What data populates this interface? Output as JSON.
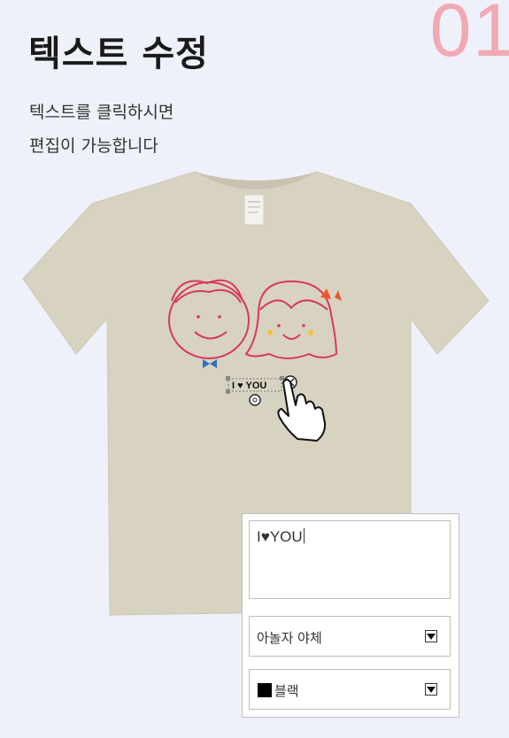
{
  "step_number": "01",
  "title": "텍스트 수정",
  "description": [
    "텍스트를 클릭하시면",
    "편집이 가능합니다"
  ],
  "design": {
    "text": "I ♥ YOU"
  },
  "editor": {
    "text_value": "I♥YOU",
    "font_select": "아놀자 야체",
    "color_select": "블랙"
  },
  "colors": {
    "shirt": "#d8d2c1",
    "accent_pink": "#f1a9b3",
    "drawing_red": "#d63a5a",
    "bow_blue": "#2d74bd",
    "bow_orange": "#f0562a"
  }
}
